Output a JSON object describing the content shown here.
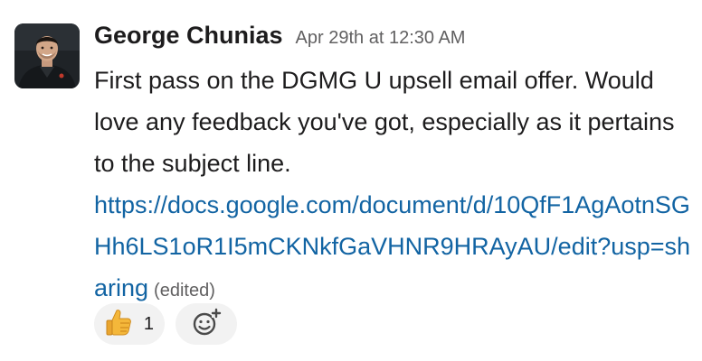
{
  "message": {
    "sender": "George Chunias",
    "timestamp": "Apr 29th at 12:30 AM",
    "text": "First pass on the DGMG U upsell email offer. Would love any feedback you've got, especially as it pertains to the subject line.",
    "link": "https://docs.google.com/document/d/10QfF1AgAotnSGHh6LS1oR1I5mCKNkfGaVHNR9HRAyAU/edit?usp=sharing",
    "edited_label": "(edited)"
  },
  "reactions": [
    {
      "icon": "thumbs-up-icon",
      "count": "1"
    }
  ],
  "add_reaction_icon": "add-emoji-icon",
  "colors": {
    "link": "#1264a3",
    "muted": "#616061",
    "text": "#1d1c1d",
    "reaction_bg": "#f2f2f2"
  }
}
